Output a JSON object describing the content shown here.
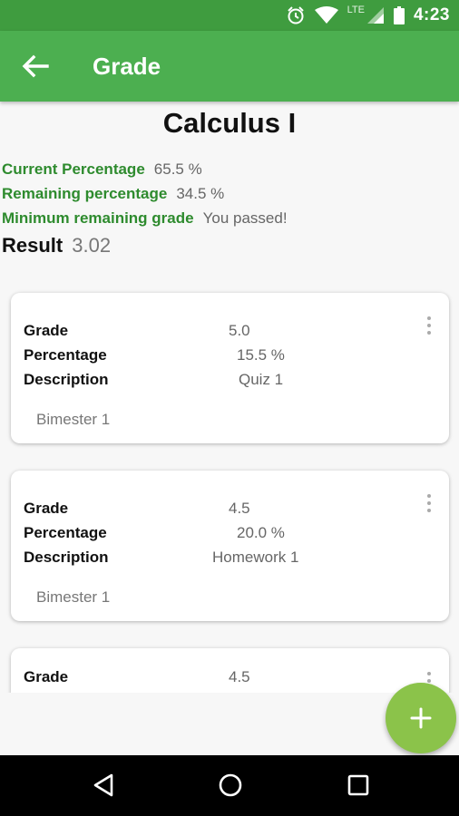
{
  "status": {
    "time": "4:23",
    "network": "LTE"
  },
  "appbar": {
    "title": "Grade"
  },
  "course": {
    "title": "Calculus I"
  },
  "summary": {
    "current_label": "Current Percentage",
    "current_value": "65.5 %",
    "remaining_label": "Remaining percentage",
    "remaining_value": "34.5 %",
    "minimum_label": "Minimum remaining grade",
    "minimum_value": "You passed!",
    "result_label": "Result",
    "result_value": "3.02"
  },
  "grades": [
    {
      "grade_label": "Grade",
      "grade": "5.0",
      "percentage_label": "Percentage",
      "percentage": "15.5 %",
      "description_label": "Description",
      "description": "Quiz 1",
      "period": "Bimester 1"
    },
    {
      "grade_label": "Grade",
      "grade": "4.5",
      "percentage_label": "Percentage",
      "percentage": "20.0 %",
      "description_label": "Description",
      "description": "Homework 1",
      "period": "Bimester 1"
    },
    {
      "grade_label": "Grade",
      "grade": "4.5"
    }
  ],
  "colors": {
    "primary": "#4caf50",
    "primary_dark": "#3f9c3f",
    "accent": "#8bc34a",
    "label_green": "#2e8b2e"
  },
  "icons": {
    "back": "arrow-left-icon",
    "menu": "more-vert-icon",
    "fab": "plus-icon",
    "alarm": "alarm-icon",
    "wifi": "wifi-icon",
    "signal": "signal-icon",
    "battery": "battery-icon"
  }
}
